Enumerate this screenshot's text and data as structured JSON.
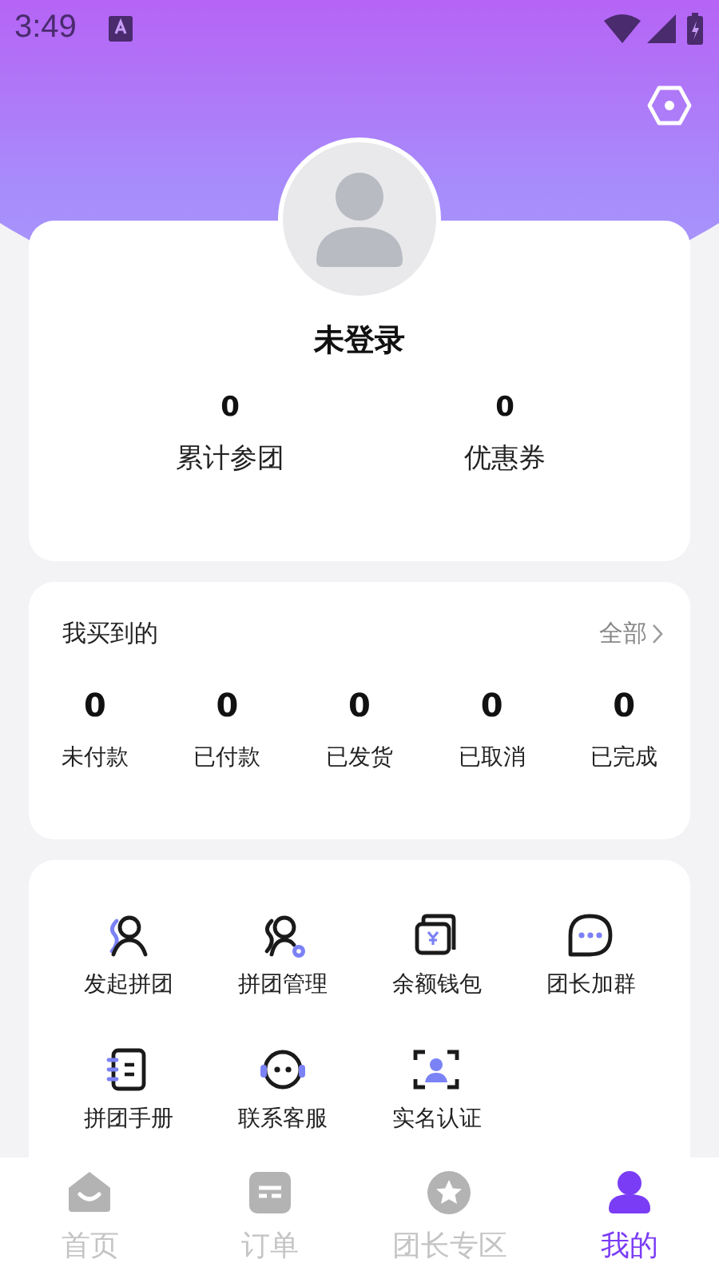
{
  "status_bar": {
    "time": "3:49"
  },
  "profile": {
    "name": "未登录",
    "stats": [
      {
        "value": "0",
        "label": "累计参团"
      },
      {
        "value": "0",
        "label": "优惠券"
      }
    ]
  },
  "orders": {
    "title": "我买到的",
    "more": "全部",
    "items": [
      {
        "count": "0",
        "label": "未付款"
      },
      {
        "count": "0",
        "label": "已付款"
      },
      {
        "count": "0",
        "label": "已发货"
      },
      {
        "count": "0",
        "label": "已取消"
      },
      {
        "count": "0",
        "label": "已完成"
      }
    ]
  },
  "services": [
    {
      "label": "发起拼团"
    },
    {
      "label": "拼团管理"
    },
    {
      "label": "余额钱包"
    },
    {
      "label": "团长加群"
    },
    {
      "label": "拼团手册"
    },
    {
      "label": "联系客服"
    },
    {
      "label": "实名认证"
    }
  ],
  "tab_bar": [
    {
      "label": "首页",
      "selected": false
    },
    {
      "label": "订单",
      "selected": false
    },
    {
      "label": "团长专区",
      "selected": false
    },
    {
      "label": "我的",
      "selected": true
    }
  ]
}
